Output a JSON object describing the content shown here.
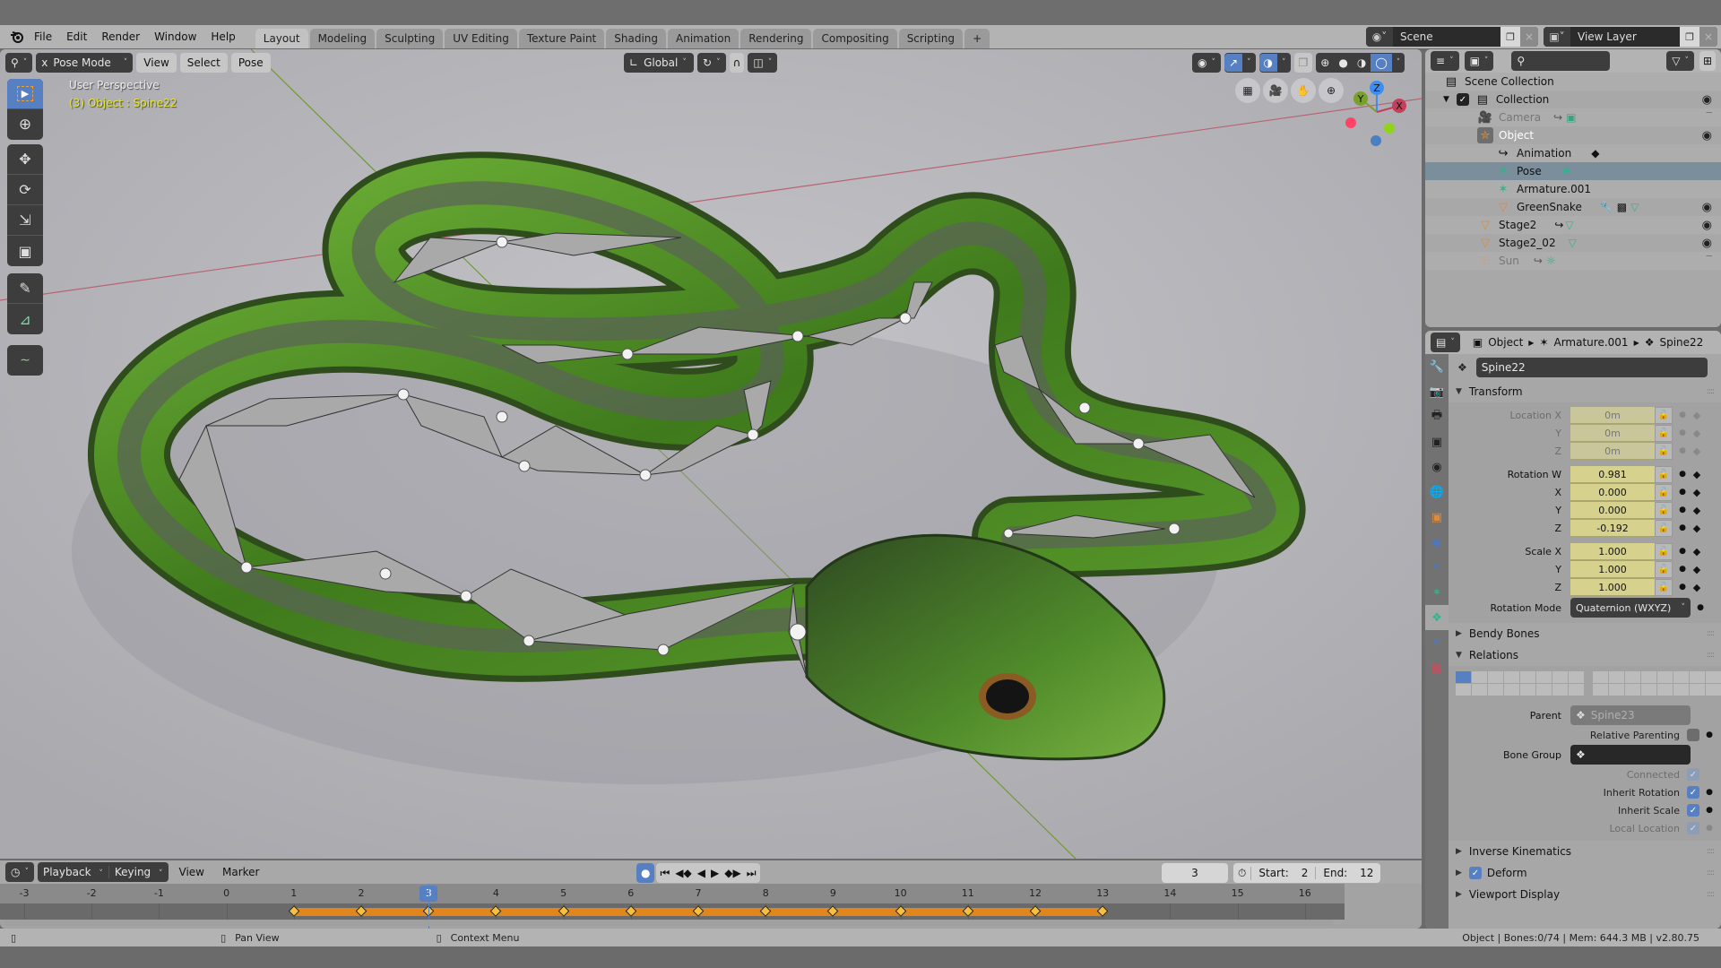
{
  "menubar": {
    "items": [
      "File",
      "Edit",
      "Render",
      "Window",
      "Help"
    ],
    "workspaces": [
      "Layout",
      "Modeling",
      "Sculpting",
      "UV Editing",
      "Texture Paint",
      "Shading",
      "Animation",
      "Rendering",
      "Compositing",
      "Scripting"
    ],
    "active_workspace": "Layout",
    "add_tab": "+",
    "scene": "Scene",
    "view_layer": "View Layer"
  },
  "viewport": {
    "mode": "Pose Mode",
    "menus": [
      "View",
      "Select",
      "Pose"
    ],
    "orientation": "Global",
    "perspective_label": "User Perspective",
    "object_label": "(3) Object : Spine22",
    "gizmo_axes": {
      "x": "X",
      "y": "Y",
      "z": "Z"
    },
    "axis_colors": {
      "x": "#c2405a",
      "y": "#7aa02c",
      "z": "#3e8ef0"
    },
    "tools": [
      "select-box",
      "cursor",
      "move",
      "rotate",
      "scale",
      "transform",
      "annotate",
      "measure",
      "bone-roll"
    ],
    "nav_buttons": [
      "grid-ortho-icon",
      "camera-icon",
      "hand-pan-icon",
      "zoom-icon"
    ]
  },
  "outliner": {
    "root": "Scene Collection",
    "rows": [
      {
        "label": "Collection",
        "icon": "collection-icon",
        "visible": true
      },
      {
        "label": "Camera",
        "icon": "camera-object-icon",
        "visible": false
      },
      {
        "label": "Object",
        "icon": "armature-object-icon",
        "visible": true
      },
      {
        "label": "Animation",
        "icon": "animation-icon",
        "visible": null
      },
      {
        "label": "Pose",
        "icon": "pose-icon",
        "visible": null,
        "selected": true
      },
      {
        "label": "Armature.001",
        "icon": "armature-data-icon",
        "visible": null
      },
      {
        "label": "GreenSnake",
        "icon": "mesh-object-icon",
        "visible": true
      },
      {
        "label": "Stage2",
        "icon": "mesh-object-icon",
        "visible": true
      },
      {
        "label": "Stage2_02",
        "icon": "mesh-object-icon",
        "visible": true
      },
      {
        "label": "Sun",
        "icon": "light-object-icon",
        "visible": false
      }
    ]
  },
  "properties": {
    "breadcrumb": [
      "Object",
      "Armature.001",
      "Spine22"
    ],
    "bone_name": "Spine22",
    "sections": {
      "transform": "Transform",
      "bendy_bones": "Bendy Bones",
      "relations": "Relations",
      "inverse_kinematics": "Inverse Kinematics",
      "deform": "Deform",
      "viewport_display": "Viewport Display"
    },
    "location": {
      "label": "Location X",
      "x": "0m",
      "y": "0m",
      "z": "0m"
    },
    "rotation": {
      "label": "Rotation W",
      "w": "0.981",
      "x": "0.000",
      "y": "0.000",
      "z": "-0.192"
    },
    "scale": {
      "label": "Scale X",
      "x": "1.000",
      "y": "1.000",
      "z": "1.000"
    },
    "axis_labels": {
      "y": "Y",
      "z": "Z",
      "x": "X"
    },
    "rotation_mode": {
      "label": "Rotation Mode",
      "value": "Quaternion (WXYZ)"
    },
    "relations": {
      "parent_label": "Parent",
      "parent_value": "Spine23",
      "relative_parenting": "Relative Parenting",
      "bone_group": "Bone Group",
      "connected": "Connected",
      "inherit_rotation": "Inherit Rotation",
      "inherit_scale": "Inherit Scale",
      "local_location": "Local Location"
    }
  },
  "timeline": {
    "menus": [
      "Playback",
      "Keying",
      "View",
      "Marker"
    ],
    "current_frame": "3",
    "start_label": "Start:",
    "start": "2",
    "end_label": "End:",
    "end": "12",
    "frames": [
      -3,
      -2,
      -1,
      0,
      1,
      2,
      3,
      4,
      5,
      6,
      7,
      8,
      9,
      10,
      11,
      12,
      13,
      14,
      15,
      16
    ],
    "keyframes": [
      1,
      2,
      3,
      4,
      5,
      6,
      7,
      8,
      9,
      10,
      11,
      12,
      13
    ],
    "key_range_color": "#e0861c"
  },
  "statusbar": {
    "pan_view": "Pan View",
    "context_menu": "Context Menu",
    "stats": "Object | Bones:0/74  | Mem: 644.3 MB | v2.80.75"
  }
}
